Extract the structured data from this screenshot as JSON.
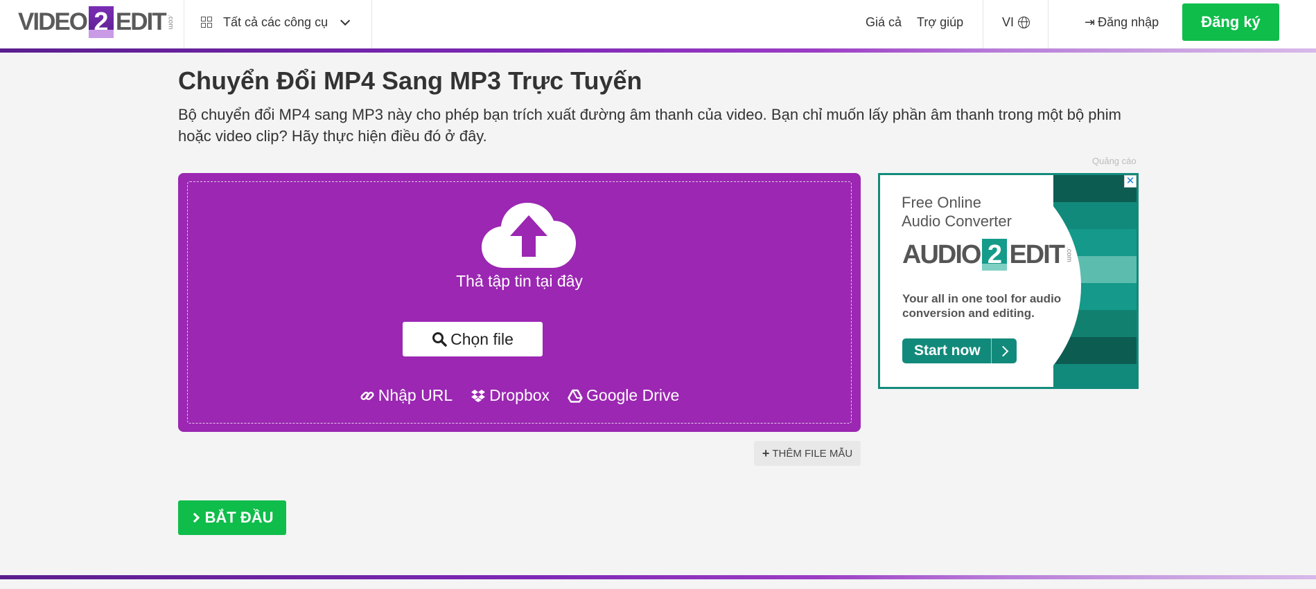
{
  "header": {
    "logo": {
      "part1": "VIDEO",
      "part2": "2",
      "part3": "EDIT",
      "suffix": ".com"
    },
    "tools_menu": {
      "label": "Tất cả các công cụ",
      "icon": "grid-icon"
    },
    "nav": {
      "pricing": "Giá cả",
      "help": "Trợ giúp",
      "language": "VI",
      "login": "Đăng nhập",
      "signup": "Đăng ký"
    }
  },
  "main": {
    "title": "Chuyển Đổi MP4 Sang MP3 Trực Tuyến",
    "description": "Bộ chuyển đổi MP4 sang MP3 này cho phép bạn trích xuất đường âm thanh của video. Bạn chỉ muốn lấy phần âm thanh trong một bộ phim hoặc video clip? Hãy thực hiện điều đó ở đây.",
    "dropzone": {
      "drop_text": "Thả tập tin tại đây",
      "choose_file": "Chọn file",
      "sources": {
        "url": "Nhập URL",
        "dropbox": "Dropbox",
        "google_drive": "Google Drive"
      }
    },
    "add_sample": "THÊM FILE MẪU",
    "start": "BẮT ĐẦU"
  },
  "ad": {
    "label": "Quảng cáo",
    "close": "✕",
    "headline_1": "Free Online",
    "headline_2": "Audio Converter",
    "logo": {
      "part1": "AUDIO",
      "part2": "2",
      "part3": "EDIT",
      "suffix": ".com"
    },
    "tagline": "Your all in one tool for audio conversion and editing.",
    "cta": "Start now"
  },
  "colors": {
    "accent_purple": "#9b27b2",
    "green": "#0fbd4a",
    "teal": "#128a7b"
  }
}
